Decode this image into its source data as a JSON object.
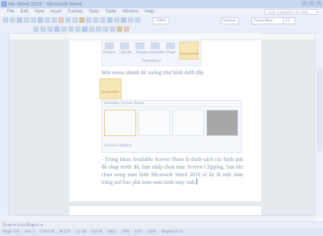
{
  "window": {
    "title": "Ms Word 2010 - Microsoft Word"
  },
  "menu": {
    "items": [
      "File",
      "Edit",
      "View",
      "Insert",
      "Format",
      "Tools",
      "Table",
      "Window",
      "Help"
    ],
    "help_placeholder": "Type a question for help"
  },
  "toolbar": {
    "zoom": "100%",
    "style": "Normal",
    "font": "Times New Roman",
    "size": "11"
  },
  "ribbon": {
    "buttons": [
      "Picture",
      "Clip Art",
      "Shapes",
      "SmartArt",
      "Chart",
      "Screenshot"
    ],
    "group": "Illustrations"
  },
  "document": {
    "para1": "Một menu nhanh đổ xuống như hình dưới đây",
    "screenshot_icon_label": "Screenshot",
    "panel_title": "Available Screen Shots",
    "clip_label": "Screen Clipping",
    "para2": "- Trong khun Available Screen Shots là danh sách các hình ảnh đã chụp trước đó, bạn nhấp chọn mục Screen Clipping. Sau khi chọn xong màn hình Microsoft Word 2010 sẽ ẩn đi một màn trắng mờ bao phủ toàn màn hình máy tính."
  },
  "drawing": {
    "label": "Draw ▾  AutoShapes ▾"
  },
  "status": {
    "items": [
      "Page 175",
      "Sec 1",
      "175/178",
      "At 3.3\"",
      "Ln 18",
      "Col 42",
      "REC",
      "TRK",
      "EXT",
      "OVR",
      "English (U.S"
    ]
  }
}
